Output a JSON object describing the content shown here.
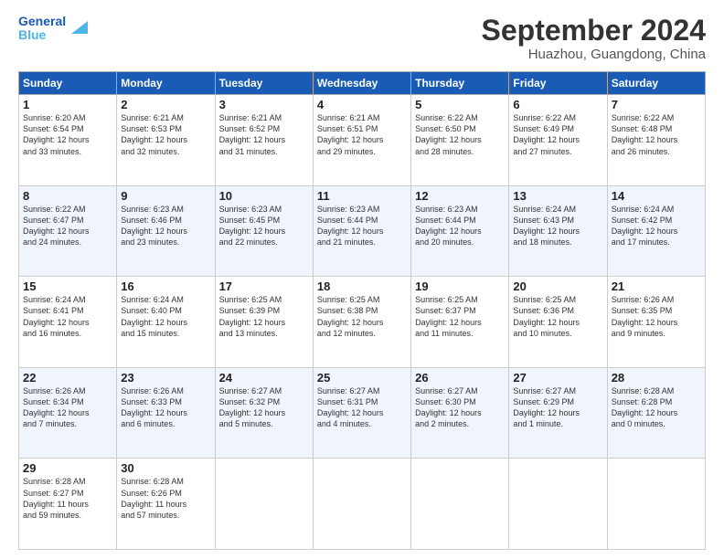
{
  "logo": {
    "line1": "General",
    "line2": "Blue"
  },
  "title": "September 2024",
  "subtitle": "Huazhou, Guangdong, China",
  "headers": [
    "Sunday",
    "Monday",
    "Tuesday",
    "Wednesday",
    "Thursday",
    "Friday",
    "Saturday"
  ],
  "weeks": [
    [
      {
        "day": "1",
        "info": "Sunrise: 6:20 AM\nSunset: 6:54 PM\nDaylight: 12 hours\nand 33 minutes."
      },
      {
        "day": "2",
        "info": "Sunrise: 6:21 AM\nSunset: 6:53 PM\nDaylight: 12 hours\nand 32 minutes."
      },
      {
        "day": "3",
        "info": "Sunrise: 6:21 AM\nSunset: 6:52 PM\nDaylight: 12 hours\nand 31 minutes."
      },
      {
        "day": "4",
        "info": "Sunrise: 6:21 AM\nSunset: 6:51 PM\nDaylight: 12 hours\nand 29 minutes."
      },
      {
        "day": "5",
        "info": "Sunrise: 6:22 AM\nSunset: 6:50 PM\nDaylight: 12 hours\nand 28 minutes."
      },
      {
        "day": "6",
        "info": "Sunrise: 6:22 AM\nSunset: 6:49 PM\nDaylight: 12 hours\nand 27 minutes."
      },
      {
        "day": "7",
        "info": "Sunrise: 6:22 AM\nSunset: 6:48 PM\nDaylight: 12 hours\nand 26 minutes."
      }
    ],
    [
      {
        "day": "8",
        "info": "Sunrise: 6:22 AM\nSunset: 6:47 PM\nDaylight: 12 hours\nand 24 minutes."
      },
      {
        "day": "9",
        "info": "Sunrise: 6:23 AM\nSunset: 6:46 PM\nDaylight: 12 hours\nand 23 minutes."
      },
      {
        "day": "10",
        "info": "Sunrise: 6:23 AM\nSunset: 6:45 PM\nDaylight: 12 hours\nand 22 minutes."
      },
      {
        "day": "11",
        "info": "Sunrise: 6:23 AM\nSunset: 6:44 PM\nDaylight: 12 hours\nand 21 minutes."
      },
      {
        "day": "12",
        "info": "Sunrise: 6:23 AM\nSunset: 6:44 PM\nDaylight: 12 hours\nand 20 minutes."
      },
      {
        "day": "13",
        "info": "Sunrise: 6:24 AM\nSunset: 6:43 PM\nDaylight: 12 hours\nand 18 minutes."
      },
      {
        "day": "14",
        "info": "Sunrise: 6:24 AM\nSunset: 6:42 PM\nDaylight: 12 hours\nand 17 minutes."
      }
    ],
    [
      {
        "day": "15",
        "info": "Sunrise: 6:24 AM\nSunset: 6:41 PM\nDaylight: 12 hours\nand 16 minutes."
      },
      {
        "day": "16",
        "info": "Sunrise: 6:24 AM\nSunset: 6:40 PM\nDaylight: 12 hours\nand 15 minutes."
      },
      {
        "day": "17",
        "info": "Sunrise: 6:25 AM\nSunset: 6:39 PM\nDaylight: 12 hours\nand 13 minutes."
      },
      {
        "day": "18",
        "info": "Sunrise: 6:25 AM\nSunset: 6:38 PM\nDaylight: 12 hours\nand 12 minutes."
      },
      {
        "day": "19",
        "info": "Sunrise: 6:25 AM\nSunset: 6:37 PM\nDaylight: 12 hours\nand 11 minutes."
      },
      {
        "day": "20",
        "info": "Sunrise: 6:25 AM\nSunset: 6:36 PM\nDaylight: 12 hours\nand 10 minutes."
      },
      {
        "day": "21",
        "info": "Sunrise: 6:26 AM\nSunset: 6:35 PM\nDaylight: 12 hours\nand 9 minutes."
      }
    ],
    [
      {
        "day": "22",
        "info": "Sunrise: 6:26 AM\nSunset: 6:34 PM\nDaylight: 12 hours\nand 7 minutes."
      },
      {
        "day": "23",
        "info": "Sunrise: 6:26 AM\nSunset: 6:33 PM\nDaylight: 12 hours\nand 6 minutes."
      },
      {
        "day": "24",
        "info": "Sunrise: 6:27 AM\nSunset: 6:32 PM\nDaylight: 12 hours\nand 5 minutes."
      },
      {
        "day": "25",
        "info": "Sunrise: 6:27 AM\nSunset: 6:31 PM\nDaylight: 12 hours\nand 4 minutes."
      },
      {
        "day": "26",
        "info": "Sunrise: 6:27 AM\nSunset: 6:30 PM\nDaylight: 12 hours\nand 2 minutes."
      },
      {
        "day": "27",
        "info": "Sunrise: 6:27 AM\nSunset: 6:29 PM\nDaylight: 12 hours\nand 1 minute."
      },
      {
        "day": "28",
        "info": "Sunrise: 6:28 AM\nSunset: 6:28 PM\nDaylight: 12 hours\nand 0 minutes."
      }
    ],
    [
      {
        "day": "29",
        "info": "Sunrise: 6:28 AM\nSunset: 6:27 PM\nDaylight: 11 hours\nand 59 minutes."
      },
      {
        "day": "30",
        "info": "Sunrise: 6:28 AM\nSunset: 6:26 PM\nDaylight: 11 hours\nand 57 minutes."
      },
      {
        "day": "",
        "info": ""
      },
      {
        "day": "",
        "info": ""
      },
      {
        "day": "",
        "info": ""
      },
      {
        "day": "",
        "info": ""
      },
      {
        "day": "",
        "info": ""
      }
    ]
  ]
}
